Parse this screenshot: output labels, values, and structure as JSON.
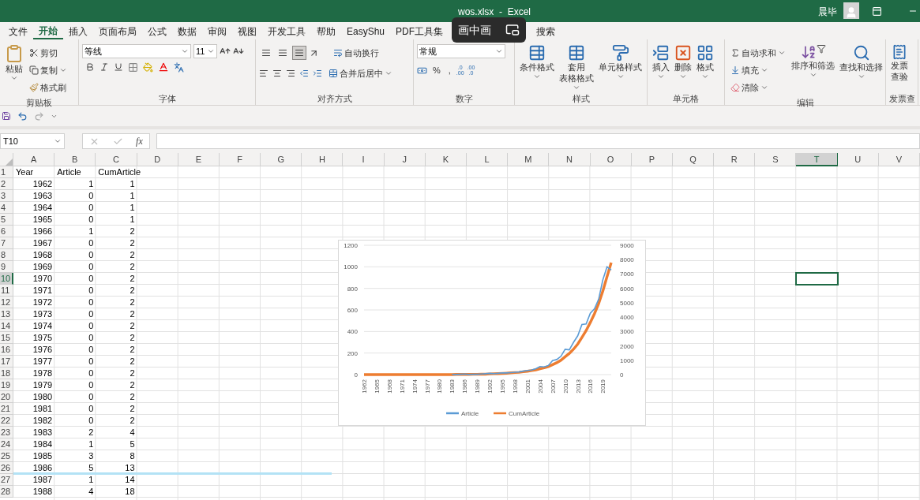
{
  "window": {
    "title": "wos.xlsx  -  Excel",
    "user": "晨毕"
  },
  "overlay": {
    "label": "画中画"
  },
  "ribbon_tabs": [
    {
      "label": "文件",
      "selected": false
    },
    {
      "label": "开始",
      "selected": true
    },
    {
      "label": "插入",
      "selected": false
    },
    {
      "label": "页面布局",
      "selected": false
    },
    {
      "label": "公式",
      "selected": false
    },
    {
      "label": "数据",
      "selected": false
    },
    {
      "label": "审阅",
      "selected": false
    },
    {
      "label": "视图",
      "selected": false
    },
    {
      "label": "开发工具",
      "selected": false
    },
    {
      "label": "帮助",
      "selected": false
    },
    {
      "label": "EasyShu",
      "selected": false
    },
    {
      "label": "PDF工具集",
      "selected": false
    },
    {
      "label": "搜索",
      "selected": false
    }
  ],
  "ribbon": {
    "clipboard": {
      "label": "剪贴板",
      "paste": "粘贴",
      "cut": "剪切",
      "copy": "复制",
      "format_painter": "格式刷"
    },
    "font": {
      "label": "字体",
      "font_name": "等线",
      "font_size": "11"
    },
    "alignment": {
      "label": "对齐方式",
      "wrap_text": "自动换行",
      "merge_center": "合并后居中",
      "vertical_align": [
        {
          "selected": false
        },
        {
          "selected": false
        },
        {
          "selected": true
        }
      ]
    },
    "number": {
      "label": "数字",
      "format": "常规",
      "percent": "%",
      "comma": ",",
      "increase_decimal": [
        ".0",
        ".00"
      ],
      "decrease_decimal": [
        ".00",
        ".0"
      ]
    },
    "styles": {
      "label": "样式",
      "items": [
        {
          "lines": [
            "条件格式"
          ]
        },
        {
          "lines": [
            "套用",
            "表格格式"
          ]
        },
        {
          "lines": [
            "单元格样式"
          ]
        }
      ]
    },
    "cells": {
      "label": "单元格",
      "items": [
        {
          "lines": [
            "插入"
          ]
        },
        {
          "lines": [
            "删除"
          ]
        },
        {
          "lines": [
            "格式"
          ]
        }
      ]
    },
    "editing": {
      "label": "编辑",
      "autosum": "自动求和",
      "fill": "填充",
      "clear": "清除",
      "sort_filter": "排序和筛选",
      "find_select": "查找和选择"
    },
    "invoice": {
      "label": "发票查",
      "lines": [
        "发票",
        "查验"
      ]
    }
  },
  "formula_bar": {
    "name_box": "T10",
    "function_label": "fx"
  },
  "sheet": {
    "columns": [
      {
        "label": "A",
        "selected": false
      },
      {
        "label": "B",
        "selected": false
      },
      {
        "label": "C",
        "selected": false
      },
      {
        "label": "D",
        "selected": false
      },
      {
        "label": "E",
        "selected": false
      },
      {
        "label": "F",
        "selected": false
      },
      {
        "label": "G",
        "selected": false
      },
      {
        "label": "H",
        "selected": false
      },
      {
        "label": "I",
        "selected": false
      },
      {
        "label": "J",
        "selected": false
      },
      {
        "label": "K",
        "selected": false
      },
      {
        "label": "L",
        "selected": false
      },
      {
        "label": "M",
        "selected": false
      },
      {
        "label": "N",
        "selected": false
      },
      {
        "label": "O",
        "selected": false
      },
      {
        "label": "P",
        "selected": false
      },
      {
        "label": "Q",
        "selected": false
      },
      {
        "label": "R",
        "selected": false
      },
      {
        "label": "S",
        "selected": false
      },
      {
        "label": "T",
        "selected": true
      },
      {
        "label": "U",
        "selected": false
      },
      {
        "label": "V",
        "selected": false
      }
    ],
    "rows": [
      {
        "number": "1",
        "selected": false,
        "kind": "header",
        "cells": [
          "Year",
          "Article",
          "CumArticle"
        ]
      },
      {
        "number": "2",
        "selected": false,
        "kind": "data",
        "cells": [
          "1962",
          "1",
          "1"
        ]
      },
      {
        "number": "3",
        "selected": false,
        "kind": "data",
        "cells": [
          "1963",
          "0",
          "1"
        ]
      },
      {
        "number": "4",
        "selected": false,
        "kind": "data",
        "cells": [
          "1964",
          "0",
          "1"
        ]
      },
      {
        "number": "5",
        "selected": false,
        "kind": "data",
        "cells": [
          "1965",
          "0",
          "1"
        ]
      },
      {
        "number": "6",
        "selected": false,
        "kind": "data",
        "cells": [
          "1966",
          "1",
          "2"
        ]
      },
      {
        "number": "7",
        "selected": false,
        "kind": "data",
        "cells": [
          "1967",
          "0",
          "2"
        ]
      },
      {
        "number": "8",
        "selected": false,
        "kind": "data",
        "cells": [
          "1968",
          "0",
          "2"
        ]
      },
      {
        "number": "9",
        "selected": false,
        "kind": "data",
        "cells": [
          "1969",
          "0",
          "2"
        ]
      },
      {
        "number": "10",
        "selected": true,
        "kind": "data",
        "cells": [
          "1970",
          "0",
          "2"
        ]
      },
      {
        "number": "11",
        "selected": false,
        "kind": "data",
        "cells": [
          "1971",
          "0",
          "2"
        ]
      },
      {
        "number": "12",
        "selected": false,
        "kind": "data",
        "cells": [
          "1972",
          "0",
          "2"
        ]
      },
      {
        "number": "13",
        "selected": false,
        "kind": "data",
        "cells": [
          "1973",
          "0",
          "2"
        ]
      },
      {
        "number": "14",
        "selected": false,
        "kind": "data",
        "cells": [
          "1974",
          "0",
          "2"
        ]
      },
      {
        "number": "15",
        "selected": false,
        "kind": "data",
        "cells": [
          "1975",
          "0",
          "2"
        ]
      },
      {
        "number": "16",
        "selected": false,
        "kind": "data",
        "cells": [
          "1976",
          "0",
          "2"
        ]
      },
      {
        "number": "17",
        "selected": false,
        "kind": "data",
        "cells": [
          "1977",
          "0",
          "2"
        ]
      },
      {
        "number": "18",
        "selected": false,
        "kind": "data",
        "cells": [
          "1978",
          "0",
          "2"
        ]
      },
      {
        "number": "19",
        "selected": false,
        "kind": "data",
        "cells": [
          "1979",
          "0",
          "2"
        ]
      },
      {
        "number": "20",
        "selected": false,
        "kind": "data",
        "cells": [
          "1980",
          "0",
          "2"
        ]
      },
      {
        "number": "21",
        "selected": false,
        "kind": "data",
        "cells": [
          "1981",
          "0",
          "2"
        ]
      },
      {
        "number": "22",
        "selected": false,
        "kind": "data",
        "cells": [
          "1982",
          "0",
          "2"
        ]
      },
      {
        "number": "23",
        "selected": false,
        "kind": "data",
        "cells": [
          "1983",
          "2",
          "4"
        ]
      },
      {
        "number": "24",
        "selected": false,
        "kind": "data",
        "cells": [
          "1984",
          "1",
          "5"
        ]
      },
      {
        "number": "25",
        "selected": false,
        "kind": "data",
        "cells": [
          "1985",
          "3",
          "8"
        ]
      },
      {
        "number": "26",
        "selected": false,
        "kind": "data",
        "cells": [
          "1986",
          "5",
          "13"
        ]
      },
      {
        "number": "27",
        "selected": false,
        "kind": "data",
        "cells": [
          "1987",
          "1",
          "14"
        ]
      },
      {
        "number": "28",
        "selected": false,
        "kind": "data",
        "cells": [
          "1988",
          "4",
          "18"
        ]
      }
    ],
    "chart": {
      "chart_data": {
        "type": "line",
        "grid": true,
        "legend": "bottom",
        "x": [
          1962,
          1963,
          1964,
          1965,
          1966,
          1967,
          1968,
          1969,
          1970,
          1971,
          1972,
          1973,
          1974,
          1975,
          1976,
          1977,
          1978,
          1979,
          1980,
          1981,
          1982,
          1983,
          1984,
          1985,
          1986,
          1987,
          1988,
          1989,
          1990,
          1991,
          1992,
          1993,
          1994,
          1995,
          1996,
          1997,
          1998,
          1999,
          2000,
          2001,
          2002,
          2003,
          2004,
          2005,
          2006,
          2007,
          2008,
          2009,
          2010,
          2011,
          2012,
          2013,
          2014,
          2015,
          2016,
          2017,
          2018,
          2019,
          2020,
          2021
        ],
        "xlim": [
          1962,
          2021
        ],
        "xticks": [
          1962,
          1965,
          1968,
          1971,
          1974,
          1977,
          1980,
          1983,
          1986,
          1989,
          1992,
          1995,
          1998,
          2001,
          2004,
          2007,
          2010,
          2013,
          2016,
          2019
        ],
        "ylim": [
          0,
          1200
        ],
        "yticks": [
          0,
          200,
          400,
          600,
          800,
          1000,
          1200
        ],
        "y2lim": [
          0,
          9000
        ],
        "y2ticks": [
          0,
          1000,
          2000,
          3000,
          4000,
          5000,
          6000,
          7000,
          8000,
          9000
        ],
        "series": [
          {
            "name": "Article",
            "color": "#5b9bd5",
            "values": [
              null,
              null,
              null,
              null,
              null,
              null,
              null,
              null,
              null,
              null,
              null,
              null,
              null,
              null,
              null,
              null,
              null,
              null,
              null,
              null,
              null,
              2,
              1,
              3,
              5,
              1,
              4,
              3,
              5,
              8,
              12,
              9,
              12,
              16,
              15,
              18,
              22,
              25,
              32,
              38,
              42,
              55,
              75,
              72,
              85,
              130,
              140,
              170,
              235,
              230,
              300,
              360,
              465,
              470,
              570,
              610,
              700,
              880,
              1000,
              970
            ]
          },
          {
            "name": "CumArticle",
            "color": "#ed7d31",
            "axis": "y2",
            "values": [
              0,
              0,
              0,
              0,
              0,
              0,
              0,
              0,
              0,
              0,
              0,
              0,
              0,
              0,
              0,
              0,
              0,
              0,
              0,
              0,
              0,
              0,
              10,
              10,
              10,
              10,
              20,
              20,
              30,
              30,
              50,
              60,
              70,
              80,
              100,
              120,
              140,
              160,
              200,
              230,
              280,
              330,
              410,
              480,
              560,
              690,
              830,
              1000,
              1240,
              1470,
              1770,
              2130,
              2590,
              3060,
              3630,
              4240,
              4940,
              5820,
              6820,
              7790
            ]
          }
        ]
      }
    }
  }
}
